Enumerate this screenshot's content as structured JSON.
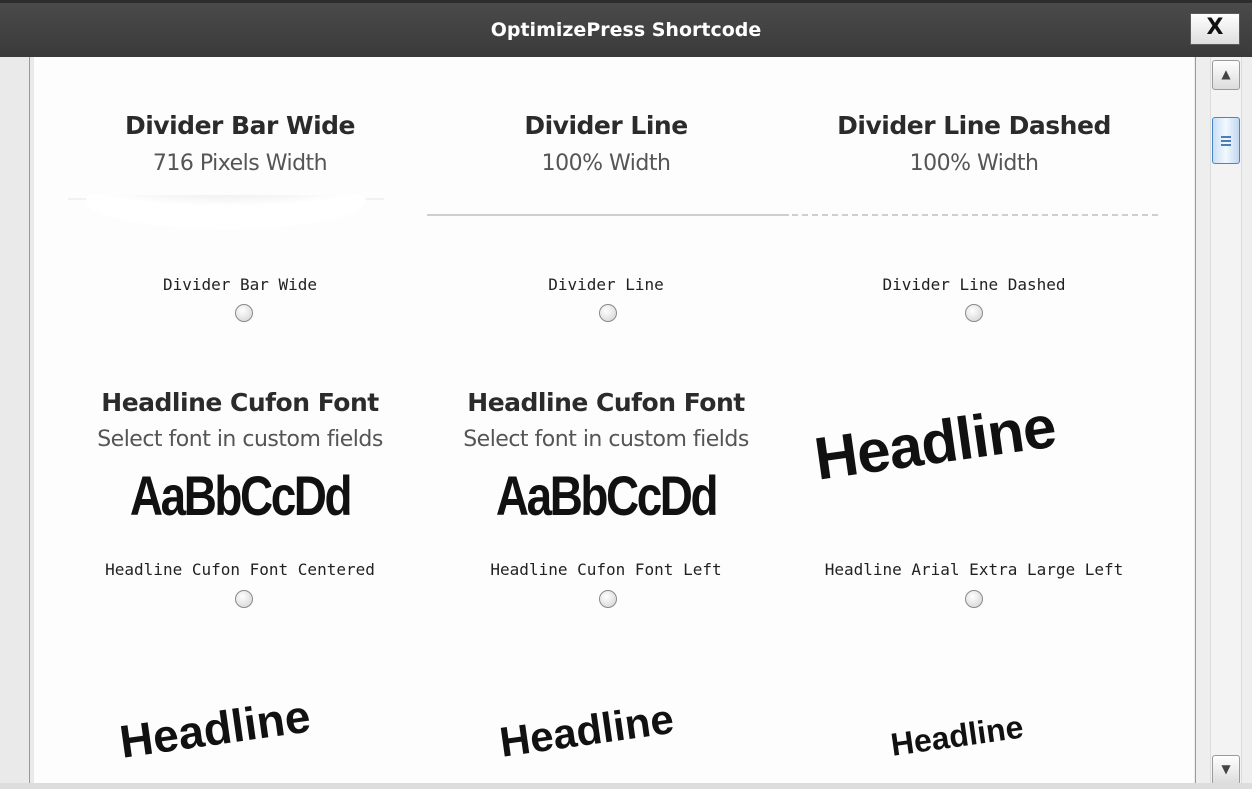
{
  "dialog": {
    "title": "OptimizePress Shortcode",
    "close_label": "X"
  },
  "scrollbar": {
    "up_arrow": "▲",
    "down_arrow": "▼"
  },
  "dividers": [
    {
      "title": "Divider Bar Wide",
      "subtitle": "716 Pixels Width",
      "option_label": "Divider Bar Wide"
    },
    {
      "title": "Divider Line",
      "subtitle": "100% Width",
      "option_label": "Divider Line"
    },
    {
      "title": "Divider Line Dashed",
      "subtitle": "100% Width",
      "option_label": "Divider Line Dashed"
    }
  ],
  "headlines": [
    {
      "title": "Headline Cufon Font",
      "subtitle": "Select font in custom fields",
      "sample": "AaBbCcDd",
      "option_label": "Headline Cufon Font Centered"
    },
    {
      "title": "Headline Cufon Font",
      "subtitle": "Select font in custom fields",
      "sample": "AaBbCcDd",
      "option_label": "Headline Cufon Font Left"
    },
    {
      "sample": "Headline",
      "option_label": "Headline Arial Extra Large Left"
    }
  ],
  "bottom_row": [
    {
      "sample": "Headline"
    },
    {
      "sample": "Headline"
    },
    {
      "sample": "Headline"
    }
  ],
  "icons": {
    "close": "close-icon",
    "radio": "radio-icon"
  }
}
